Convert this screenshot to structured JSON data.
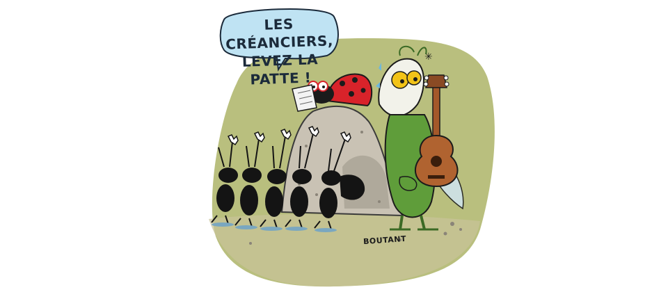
{
  "speech_bubble": {
    "line1": "LES CRÉANCIERS,",
    "line2": "LEVEZ LA PATTE !"
  },
  "signature": "BOUTANT",
  "colors": {
    "background_blob": "#b9bf7e",
    "bubble": "#bfe3f3",
    "ant": "#141414",
    "anthill": "#c9c2b4",
    "ladybug": "#d8232a",
    "grasshopper": "#5f9d3a",
    "guitar": "#a4582a"
  },
  "icons": [
    "speech-bubble",
    "ant-icon",
    "ladybug-icon",
    "grasshopper-icon",
    "guitar-icon",
    "anthill-icon"
  ]
}
